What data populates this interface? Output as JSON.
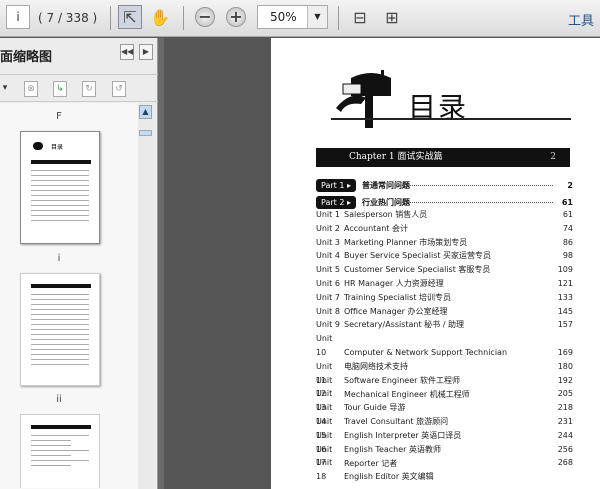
{
  "toolbar": {
    "page_input": "i",
    "page_count": "( 7 / 338 )",
    "zoom": "50%",
    "tools": "工具"
  },
  "sidebar": {
    "title": "面缩略图",
    "thumb_labels": [
      "F",
      "i",
      "ii"
    ]
  },
  "page": {
    "title": "目录",
    "chapter": "Chapter 1   面试实战篇",
    "chapter_page": "2",
    "parts": [
      {
        "label": "Part 1 ▸",
        "title": "普通常问问题",
        "page": "2"
      },
      {
        "label": "Part 2 ▸",
        "title": "行业热门问题",
        "page": "61"
      }
    ],
    "units": [
      {
        "unit": "Unit 1",
        "title": "Salesperson 销售人员",
        "page": "61"
      },
      {
        "unit": "Unit 2",
        "title": "Accountant 会计",
        "page": "74"
      },
      {
        "unit": "Unit 3",
        "title": "Marketing Planner 市场策划专员",
        "page": "86"
      },
      {
        "unit": "Unit 4",
        "title": "Buyer Service Specialist 买家运营专员",
        "page": "98"
      },
      {
        "unit": "Unit 5",
        "title": "Customer Service Specialist 客服专员",
        "page": "109"
      },
      {
        "unit": "Unit 6",
        "title": "HR Manager 人力资源经理",
        "page": "121"
      },
      {
        "unit": "Unit 7",
        "title": "Training Specialist 培训专员",
        "page": "133"
      },
      {
        "unit": "Unit 8",
        "title": "Office Manager 办公室经理",
        "page": "145"
      },
      {
        "unit": "Unit 9",
        "title": "Secretary/Assistant 秘书 / 助理",
        "page": "157"
      },
      {
        "unit": "Unit 10",
        "title": "Computer & Network Support Technician",
        "title2": "电脑网络技术支持",
        "page": "169"
      },
      {
        "unit": "Unit 11",
        "title": "Software Engineer 软件工程师",
        "page": "180"
      },
      {
        "unit": "Unit 12",
        "title": "Mechanical Engineer 机械工程师",
        "page": "192"
      },
      {
        "unit": "Unit 13",
        "title": "Tour Guide 导游",
        "page": "205"
      },
      {
        "unit": "Unit 14",
        "title": "Travel Consultant 旅游顾问",
        "page": "218"
      },
      {
        "unit": "Unit 15",
        "title": "English Interpreter 英语口译员",
        "page": "231"
      },
      {
        "unit": "Unit 16",
        "title": "English Teacher 英语教师",
        "page": "244"
      },
      {
        "unit": "Unit 17",
        "title": "Reporter 记者",
        "page": "256"
      },
      {
        "unit": "Unit 18",
        "title": "English Editor 英文编辑",
        "page": "268"
      }
    ]
  }
}
